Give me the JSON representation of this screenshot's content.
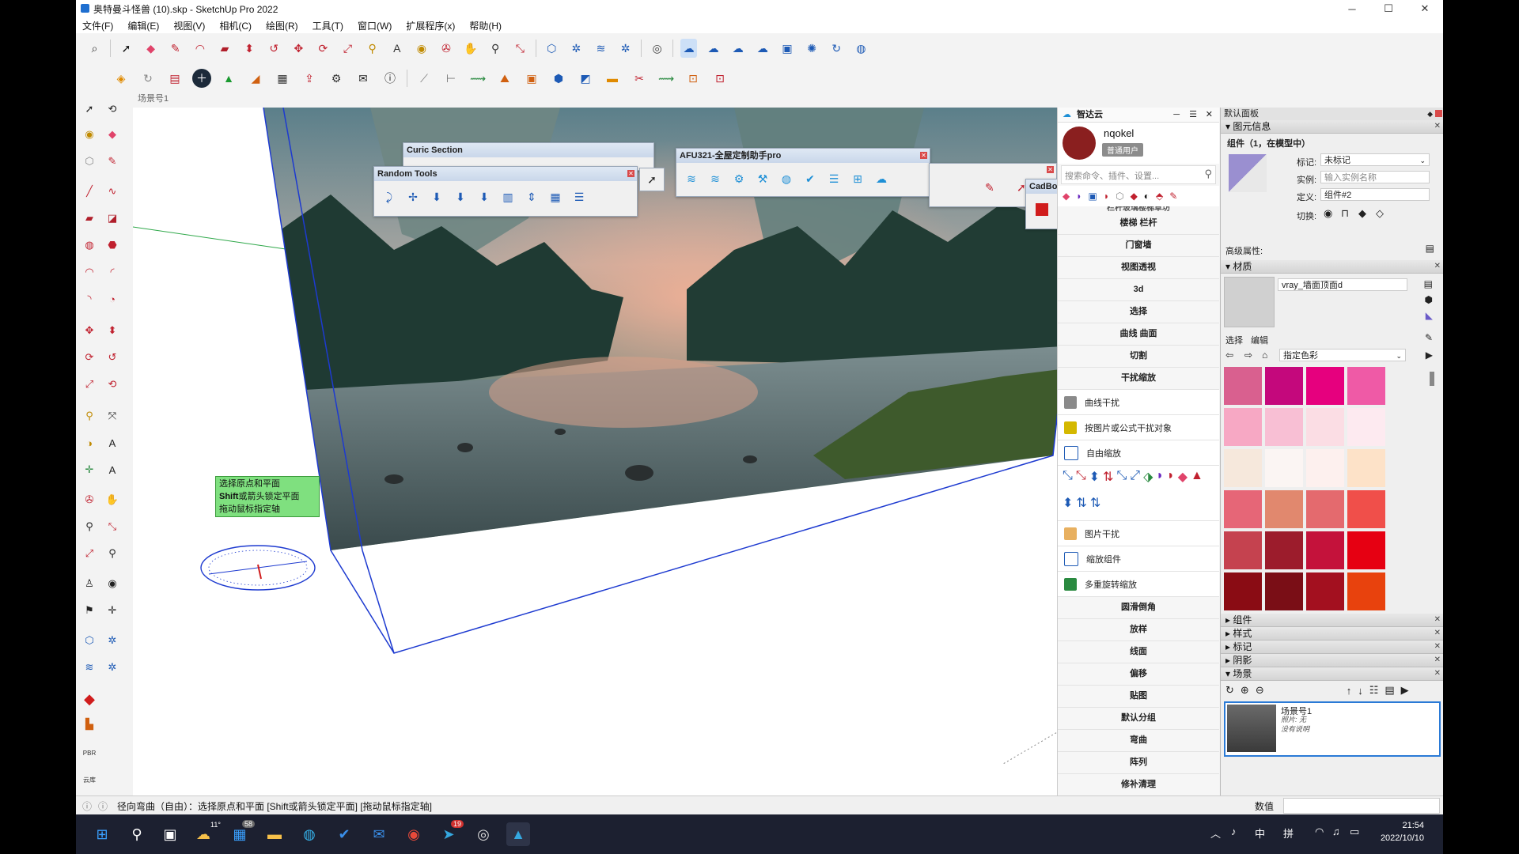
{
  "window": {
    "title": "奥特曼斗怪兽 (10).skp - SketchUp Pro 2022",
    "minimize": "─",
    "maximize": "☐",
    "close": "✕"
  },
  "menu": [
    "文件(F)",
    "编辑(E)",
    "视图(V)",
    "相机(C)",
    "绘图(R)",
    "工具(T)",
    "窗口(W)",
    "扩展程序(x)",
    "帮助(H)"
  ],
  "scene_tab": "场景号1",
  "floating": {
    "curic": "Curic Section",
    "random": "Random Tools",
    "afu": "AFU321-全屋定制助手pro",
    "cadb": "CadBo"
  },
  "tooltip": {
    "line1": "选择原点和平面",
    "line2_bold": "Shift",
    "line2_rest": "或箭头锁定平面",
    "line3": "拖动鼠标指定轴"
  },
  "zhidayun": {
    "title": "智达云",
    "username": "nqokel",
    "user_badge": "普通用户",
    "search_placeholder": "搜索命令、插件、设置...",
    "partial_item": "栏杆玻璃楼梯草坊",
    "menu_items_top": [
      "楼梯 栏杆",
      "门窗墙",
      "视图透视",
      "3d",
      "选择",
      "曲线 曲面",
      "切割",
      "干扰缩放"
    ],
    "tool_rows_a": [
      "曲线干扰",
      "按图片或公式干扰对象",
      "自由缩放"
    ],
    "tool_rows_b": [
      "图片干扰",
      "缩放组件",
      "多重旋转缩放"
    ],
    "menu_items_bottom": [
      "圆滑倒角",
      "放样",
      "线面",
      "偏移",
      "贴图",
      "默认分组",
      "弯曲",
      "阵列",
      "修补清理"
    ]
  },
  "default_panel": {
    "title": "默认面板",
    "entity_info": {
      "header": "图元信息",
      "component": "组件（1，在模型中）",
      "tag_label": "标记:",
      "tag_value": "未标记",
      "instance_label": "实例:",
      "instance_placeholder": "输入实例名称",
      "definition_label": "定义:",
      "definition_value": "组件#2",
      "toggle_label": "切换:",
      "advanced": "高级属性:"
    },
    "materials": {
      "header": "材质",
      "current": "vray_墙面顶面d",
      "tab_select": "选择",
      "tab_edit": "编辑",
      "dropdown": "指定色彩",
      "swatches": [
        "#d9608f",
        "#c4087c",
        "#e6007e",
        "#ef5aa6",
        "#f7a8c4",
        "#f8bfd4",
        "#fbdde4",
        "#fdeaf0",
        "#f6e8dc",
        "#fbf5f3",
        "#fdf0ee",
        "#fde2c8",
        "#e66677",
        "#e1886e",
        "#e46a6e",
        "#f04f4a",
        "#c5424f",
        "#9c1c2c",
        "#c4123b",
        "#e60012",
        "#8a0c14",
        "#7a0e16",
        "#a3101f",
        "#e8420d"
      ]
    },
    "collapsed_sections": [
      "组件",
      "样式",
      "标记",
      "阴影"
    ],
    "scenes": {
      "header": "场景",
      "scene_name": "场景号1",
      "scene_photo": "照片: 无",
      "scene_desc": "没有说明"
    }
  },
  "status_bar": {
    "message": "径向弯曲（自由）：选择原点和平面 [Shift或箭头锁定平面] [拖动鼠标指定轴]",
    "measure_label": "数值"
  },
  "taskbar": {
    "weather_badge": "11°",
    "mail_badge": "58",
    "telegram_badge": "19",
    "ime_lang": "中",
    "ime_mode": "拼",
    "time": "21:54",
    "date": "2022/10/10"
  },
  "colors": {
    "accent_blue": "#0a3dbe",
    "selection_blue": "#1d3ad0",
    "tooltip_green": "#7fe07f"
  }
}
